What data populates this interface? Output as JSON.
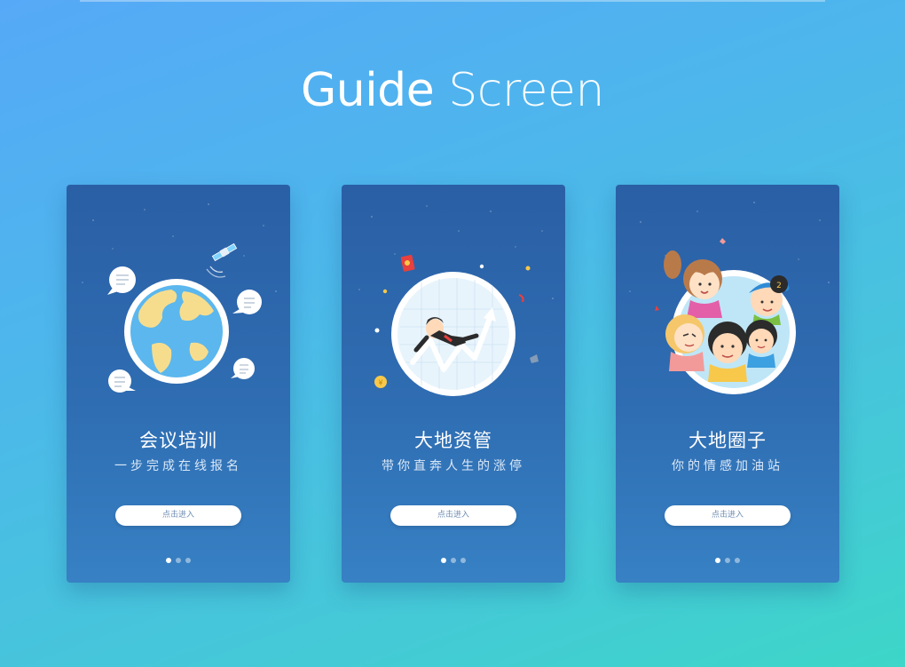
{
  "header": {
    "title_part1": "Guide",
    "title_part2": "Screen"
  },
  "colors": {
    "background_top": "#56a9f7",
    "background_bottom": "#3dd6c8",
    "card_top": "#2a5fa5",
    "card_bottom": "#3781c4",
    "button_bg": "#ffffff",
    "button_text": "#6f8db3"
  },
  "cards": [
    {
      "title": "会议培训",
      "subtitle": "一步完成在线报名",
      "button_label": "点击进入",
      "illustration": "globe-with-chat-bubbles-and-satellite",
      "active_dot": 1,
      "dot_count": 3
    },
    {
      "title": "大地资管",
      "subtitle": "带你直奔人生的涨停",
      "button_label": "点击进入",
      "illustration": "businessman-riding-rising-chart",
      "active_dot": 1,
      "dot_count": 3
    },
    {
      "title": "大地圈子",
      "subtitle": "你的情感加油站",
      "button_label": "点击进入",
      "illustration": "group-of-cartoon-people",
      "active_dot": 1,
      "dot_count": 3
    }
  ]
}
